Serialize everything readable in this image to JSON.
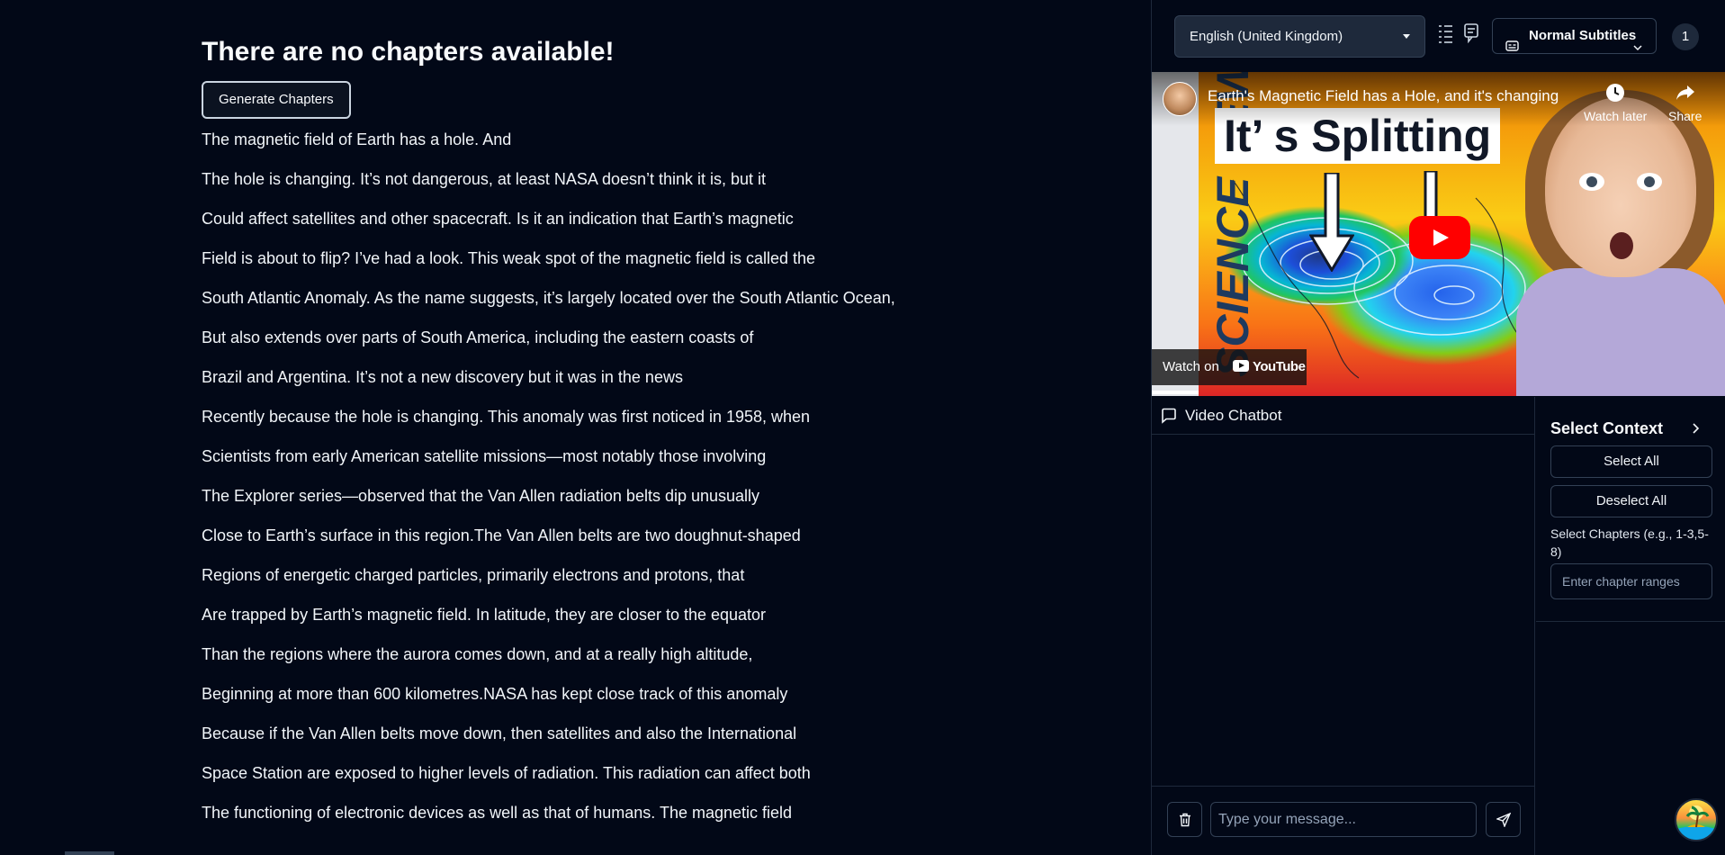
{
  "transcript": {
    "heading": "There are no chapters available!",
    "generate_button": "Generate Chapters",
    "lines": [
      "The magnetic field of Earth has a hole. And",
      "The hole is changing. It’s not dangerous,  at least NASA doesn’t think it is, but it",
      "Could affect satellites and other spacecraft.  Is it an indication that Earth’s magnetic",
      "Field is about to flip? I’ve had a look. This weak spot of the magnetic field is called the",
      "South Atlantic Anomaly. As the name suggests, it’s  largely located over the South Atlantic Ocean,",
      "But also extends over parts of South America,  including the eastern coasts of",
      "Brazil and Argentina. It’s not  a new discovery but it was in the news",
      "Recently because the hole is changing. This anomaly was first noticed in 1958, when",
      "Scientists from early American satellite  missions—most notably those involving",
      "The Explorer series—observed that the  Van Allen radiation belts dip unusually",
      "Close to Earth’s surface in this region.The Van Allen belts are two doughnut-shaped",
      "Regions of energetic charged particles,  primarily electrons and protons, that",
      "Are trapped by Earth’s magnetic field.  In latitude, they are closer to the equator",
      "Than the regions where the aurora comes down,  and at a really high altitude,",
      "Beginning at more than 600 kilometres.NASA has kept close track of this anomaly",
      "Because if the Van Allen belts move down,  then satellites and also the International",
      "Space Station are exposed to higher levels of  radiation. This radiation can affect both",
      "The functioning of electronic devices as  well as that of humans. The magnetic field"
    ]
  },
  "toolbar": {
    "language": "English (United Kingdom)",
    "subtitles_mode": "Normal Subtitles",
    "badge_count": "1",
    "icons": [
      "list-icon",
      "subtitles-icon",
      "captions-icon",
      "chevron-down-icon"
    ]
  },
  "video": {
    "title": "Earth's Magnetic Field has a Hole, and it's changing",
    "thumbnail_headline": "It’ s Splitting",
    "thumbnail_side_text": "SCIENCE NEWS",
    "watch_later": "Watch later",
    "share": "Share",
    "watch_on": "Watch on",
    "youtube": "YouTube"
  },
  "chatbot": {
    "title": "Video Chatbot",
    "input_placeholder": "Type your message...",
    "input_value": ""
  },
  "context": {
    "title": "Select Context",
    "select_all": "Select All",
    "deselect_all": "Deselect All",
    "chapters_label": "Select Chapters (e.g., 1-3,5-8)",
    "chapters_placeholder": "Enter chapter ranges"
  },
  "colors": {
    "background": "#020817",
    "border": "#1e293b",
    "youtube_red": "#ff0000"
  }
}
